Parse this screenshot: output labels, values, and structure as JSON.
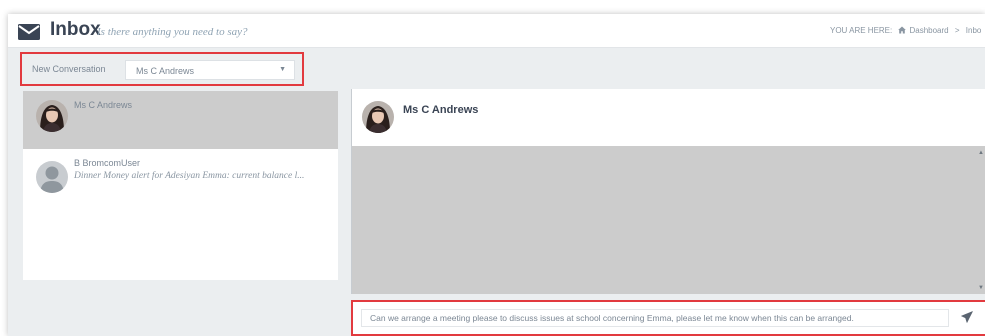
{
  "header": {
    "title": "Inbox",
    "subtitle": "Is there anything you need to say?",
    "breadcrumb": {
      "prefix": "YOU ARE HERE:",
      "home": "Dashboard",
      "separator": ">",
      "current": "Inbo"
    }
  },
  "new_conversation": {
    "label": "New Conversation",
    "selected": "Ms C Andrews"
  },
  "conversations": [
    {
      "name": "Ms C Andrews",
      "preview": "",
      "avatar": "photo",
      "active": true
    },
    {
      "name": "B BromcomUser",
      "preview": "Dinner Money alert for Adesiyan Emma: current balance l...",
      "avatar": "default-user",
      "active": false
    }
  ],
  "chat": {
    "name": "Ms C Andrews"
  },
  "composer": {
    "value": "Can we arrange a meeting please to discuss issues at school concerning Emma, please let me know when this can be arranged."
  },
  "icons": {
    "inbox": "envelope-icon",
    "home": "home-icon",
    "send": "paper-plane-icon",
    "dropdown": "caret-down-icon"
  },
  "colors": {
    "highlight_border": "#e23a3f",
    "active_item": "#cccccc",
    "title": "#3a4454"
  }
}
